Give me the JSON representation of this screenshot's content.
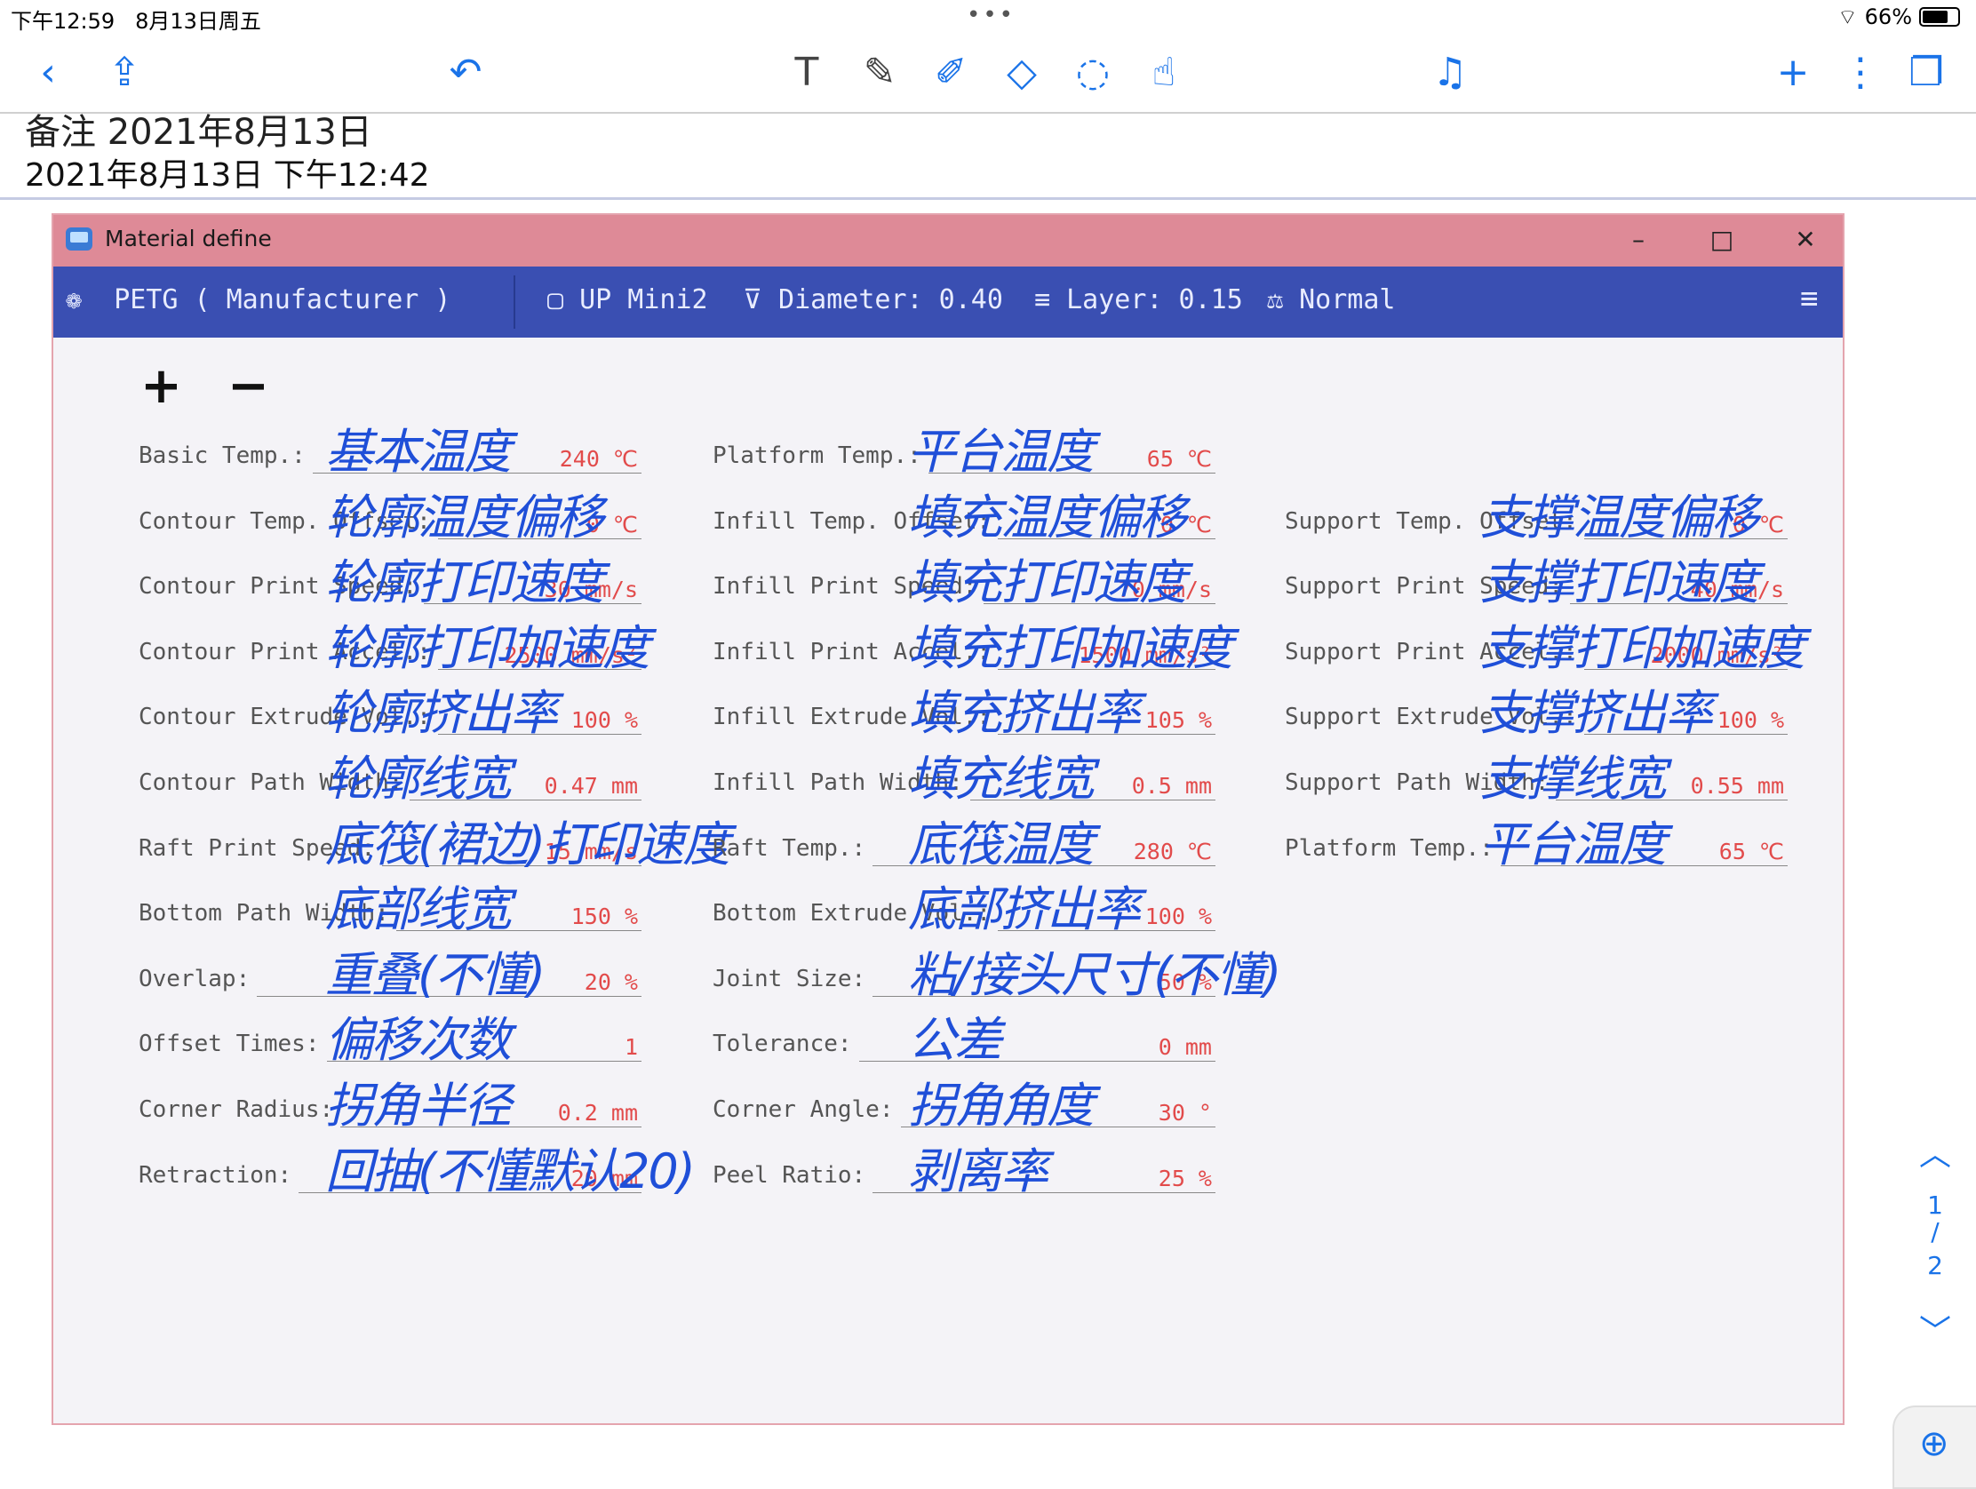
{
  "status": {
    "time": "下午12:59",
    "date": "8月13日周五",
    "dots": "•••",
    "wifi": "⌔",
    "battery": "66%"
  },
  "toolbar_icons": [
    "chevron-left-icon",
    "share-icon",
    "undo-icon",
    "text-tool-icon",
    "pen-icon",
    "highlighter-icon",
    "eraser-icon",
    "lasso-icon",
    "hand-icon",
    "microphone-icon",
    "add-icon",
    "more-icon",
    "pages-icon"
  ],
  "note": {
    "title": "备注 2021年8月13日",
    "datetime": "2021年8月13日 下午12:42"
  },
  "window": {
    "title": "Material define",
    "min": "–",
    "max": "□",
    "close": "✕",
    "nav": {
      "material": "PETG ( Manufacturer )",
      "printer": "UP Mini2",
      "diameter": "Diameter: 0.40",
      "layer": "Layer: 0.15",
      "mode": "Normal",
      "menu": "≡"
    },
    "plus": "+",
    "minus": "−"
  },
  "fields": [
    {
      "label": "Basic Temp.:",
      "value": "240 ℃",
      "note": "基本温度"
    },
    {
      "label": "Platform Temp.:",
      "value": "65 ℃",
      "note": "平台温度"
    },
    {
      "label": "Contour Temp. Offset:",
      "value": "0 ℃",
      "note": "轮廓温度偏移"
    },
    {
      "label": "Infill Temp. Offset:",
      "value": "0 ℃",
      "note": "填充温度偏移"
    },
    {
      "label": "Support Temp. Offset:",
      "value": "0 ℃",
      "note": "支撑温度偏移"
    },
    {
      "label": "Contour Print Speed:",
      "value": "30 mm/s",
      "note": "轮廓打印速度"
    },
    {
      "label": "Infill Print Speed:",
      "value": "70 mm/s",
      "note": "填充打印速度"
    },
    {
      "label": "Support Print Speed:",
      "value": "40 mm/s",
      "note": "支撑打印速度"
    },
    {
      "label": "Contour Print Accel.:",
      "value": "2500 mm/s²",
      "note": "轮廓打印加速度"
    },
    {
      "label": "Infill Print Accel.:",
      "value": "1500 mm/s²",
      "note": "填充打印加速度"
    },
    {
      "label": "Support Print Accel.:",
      "value": "2000 mm/s²",
      "note": "支撑打印加速度"
    },
    {
      "label": "Contour Extrude Vol.:",
      "value": "100 %",
      "note": "轮廓挤出率"
    },
    {
      "label": "Infill Extrude Vol.:",
      "value": "105 %",
      "note": "填充挤出率"
    },
    {
      "label": "Support Extrude Vol.:",
      "value": "100 %",
      "note": "支撑挤出率"
    },
    {
      "label": "Contour Path Width:",
      "value": "0.47 mm",
      "note": "轮廓线宽"
    },
    {
      "label": "Infill Path Width:",
      "value": "0.5 mm",
      "note": "填充线宽"
    },
    {
      "label": "Support Path Width:",
      "value": "0.55 mm",
      "note": "支撑线宽"
    },
    {
      "label": "Raft Print Speed:",
      "value": "15 mm/s",
      "note": "底筏(裙边)打印速度"
    },
    {
      "label": "Raft Temp.:",
      "value": "280 ℃",
      "note": "底筏温度"
    },
    {
      "label": "Platform Temp.:",
      "value": "65 ℃",
      "note": "平台温度"
    },
    {
      "label": "Bottom Path Width:",
      "value": "150 %",
      "note": "底部线宽"
    },
    {
      "label": "Bottom Extrude Vol.:",
      "value": "100 %",
      "note": "底部挤出率"
    },
    {
      "label": "Overlap:",
      "value": "20 %",
      "note": "重叠(不懂)"
    },
    {
      "label": "Joint Size:",
      "value": "50 %",
      "note": "粘/接头尺寸(不懂)"
    },
    {
      "label": "Offset Times:",
      "value": "1",
      "note": "偏移次数"
    },
    {
      "label": "Tolerance:",
      "value": "0 mm",
      "note": "公差"
    },
    {
      "label": "Corner Radius:",
      "value": "0.2 mm",
      "note": "拐角半径"
    },
    {
      "label": "Corner Angle:",
      "value": "30 °",
      "note": "拐角角度"
    },
    {
      "label": "Retraction:",
      "value": "20 mm",
      "note": "回抽(不懂默认20)"
    },
    {
      "label": "Peel Ratio:",
      "value": "25 %",
      "note": "剥离率"
    }
  ],
  "pager": {
    "up": "︿",
    "current": "1",
    "sep": "/",
    "total": "2",
    "down": "﹀"
  },
  "zoom": "⊕"
}
